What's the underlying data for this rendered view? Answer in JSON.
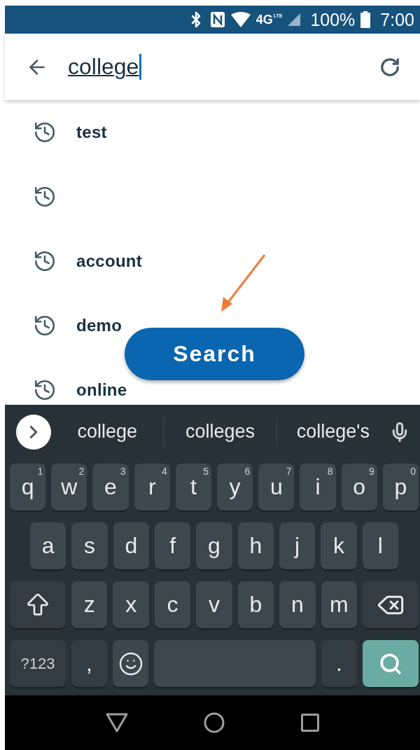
{
  "status_bar": {
    "network": "4G",
    "network_sub": "LTE",
    "battery": "100%",
    "time": "7:00"
  },
  "search_bar": {
    "value": "college"
  },
  "history": [
    {
      "kind": "query",
      "label": "test"
    },
    {
      "kind": "blank"
    },
    {
      "kind": "query",
      "label": "account"
    },
    {
      "kind": "query",
      "label": "demo"
    },
    {
      "kind": "query",
      "label": "online"
    }
  ],
  "search_button": {
    "label": "Search"
  },
  "keyboard": {
    "suggestions": [
      "college",
      "colleges",
      "college's"
    ],
    "rows": [
      {
        "keys": [
          {
            "kind": "letter",
            "label": "q",
            "hint": "1"
          },
          {
            "kind": "letter",
            "label": "w",
            "hint": "2"
          },
          {
            "kind": "letter",
            "label": "e",
            "hint": "3"
          },
          {
            "kind": "letter",
            "label": "r",
            "hint": "4"
          },
          {
            "kind": "letter",
            "label": "t",
            "hint": "5"
          },
          {
            "kind": "letter",
            "label": "y",
            "hint": "6"
          },
          {
            "kind": "letter",
            "label": "u",
            "hint": "7"
          },
          {
            "kind": "letter",
            "label": "i",
            "hint": "8"
          },
          {
            "kind": "letter",
            "label": "o",
            "hint": "9"
          },
          {
            "kind": "letter",
            "label": "p",
            "hint": "0"
          }
        ]
      },
      {
        "keys": [
          {
            "kind": "letter",
            "label": "a"
          },
          {
            "kind": "letter",
            "label": "s"
          },
          {
            "kind": "letter",
            "label": "d"
          },
          {
            "kind": "letter",
            "label": "f"
          },
          {
            "kind": "letter",
            "label": "g"
          },
          {
            "kind": "letter",
            "label": "h"
          },
          {
            "kind": "letter",
            "label": "j"
          },
          {
            "kind": "letter",
            "label": "k"
          },
          {
            "kind": "letter",
            "label": "l"
          }
        ]
      },
      {
        "keys": [
          {
            "kind": "shift"
          },
          {
            "kind": "letter",
            "label": "z"
          },
          {
            "kind": "letter",
            "label": "x"
          },
          {
            "kind": "letter",
            "label": "c"
          },
          {
            "kind": "letter",
            "label": "v"
          },
          {
            "kind": "letter",
            "label": "b"
          },
          {
            "kind": "letter",
            "label": "n"
          },
          {
            "kind": "letter",
            "label": "m"
          },
          {
            "kind": "backspace"
          }
        ]
      },
      {
        "keys": [
          {
            "kind": "symbols",
            "label": "?123"
          },
          {
            "kind": "punct",
            "label": ","
          },
          {
            "kind": "emoji"
          },
          {
            "kind": "space"
          },
          {
            "kind": "punct",
            "label": "."
          },
          {
            "kind": "action"
          }
        ]
      }
    ]
  }
}
